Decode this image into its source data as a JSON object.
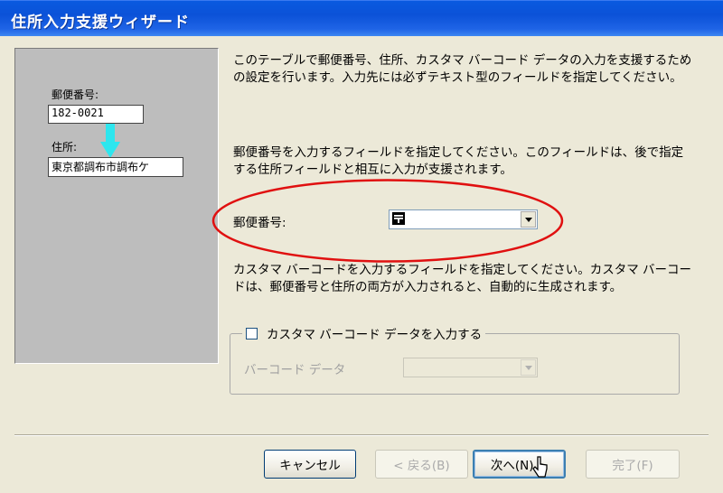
{
  "window": {
    "title": "住所入力支援ウィザード"
  },
  "preview": {
    "postal_label": "郵便番号:",
    "postal_value": "182-0021",
    "address_label": "住所:",
    "address_value": "東京都調布市調布ケ"
  },
  "text": {
    "intro": "このテーブルで郵便番号、住所、カスタマ バーコード データの入力を支援するための設定を行います。入力先には必ずテキスト型のフィールドを指定してください。",
    "postal_instruction": "郵便番号を入力するフィールドを指定してください。このフィールドは、後で指定する住所フィールドと相互に入力が支援されます。",
    "barcode_instruction": "カスタマ バーコードを入力するフィールドを指定してください。カスタマ バーコードは、郵便番号と住所の両方が入力されると、自動的に生成されます。"
  },
  "postal_field": {
    "label": "郵便番号:",
    "value": "〒",
    "dropdown_icon": "chevron-down-icon"
  },
  "barcode_group": {
    "checkbox_label": "カスタマ バーコード データを入力する",
    "checked": false,
    "field_label": "バーコード データ",
    "field_value": ""
  },
  "buttons": {
    "cancel": "キャンセル",
    "back": "< 戻る(B)",
    "next": "次へ(N) >",
    "finish": "完了(F)"
  },
  "colors": {
    "titlebar": "#0b52d8",
    "highlight_ellipse": "#e01010",
    "arrow": "#2ee6ee"
  }
}
